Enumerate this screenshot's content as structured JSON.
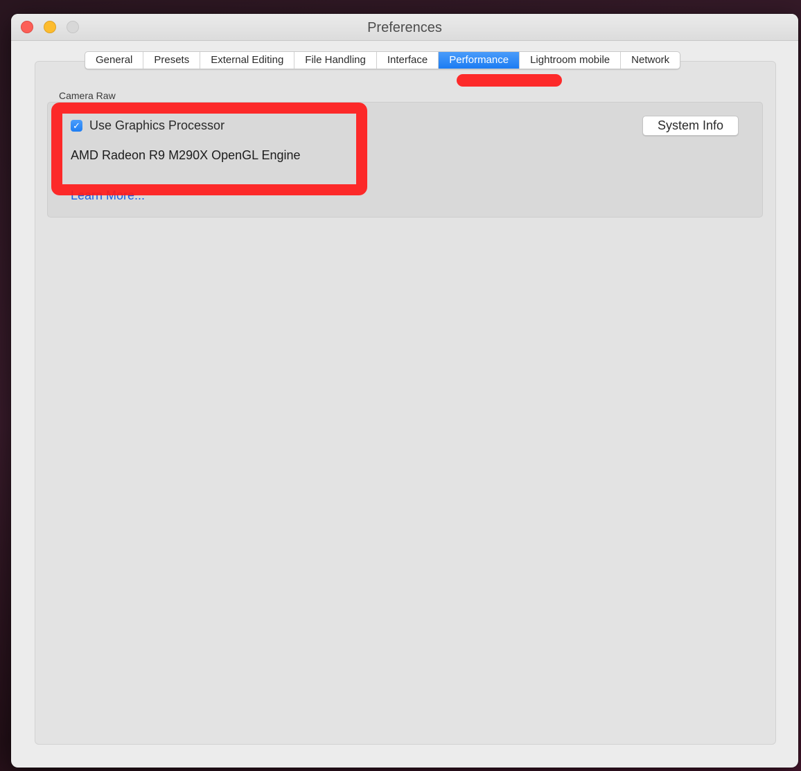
{
  "window": {
    "title": "Preferences"
  },
  "tabs": [
    {
      "label": "General",
      "active": false
    },
    {
      "label": "Presets",
      "active": false
    },
    {
      "label": "External Editing",
      "active": false
    },
    {
      "label": "File Handling",
      "active": false
    },
    {
      "label": "Interface",
      "active": false
    },
    {
      "label": "Performance",
      "active": true
    },
    {
      "label": "Lightroom mobile",
      "active": false
    },
    {
      "label": "Network",
      "active": false
    }
  ],
  "camera_raw": {
    "section_label": "Camera Raw",
    "use_gpu_label": "Use Graphics Processor",
    "use_gpu_checked": true,
    "gpu_name": "AMD Radeon R9 M290X OpenGL Engine",
    "learn_more_label": "Learn More...",
    "system_info_label": "System Info"
  },
  "icons": {
    "checkbox_mark": "checkmark-icon"
  },
  "colors": {
    "accent": "#1b7cf3",
    "link": "#1760e6",
    "annotation": "#ff1a1a"
  }
}
